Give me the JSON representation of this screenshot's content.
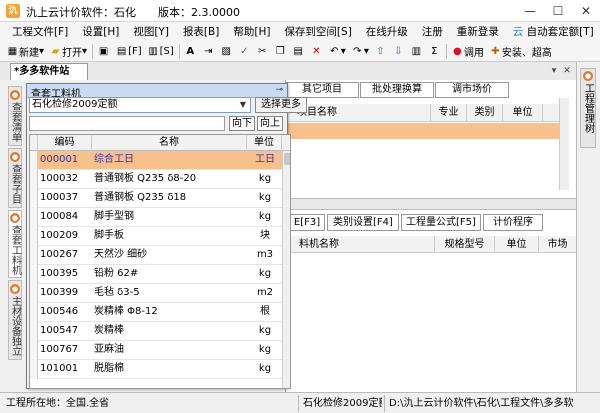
{
  "window": {
    "title": "氿上云计价软件：石化　　版本：2.3.0000",
    "controls": [
      "—",
      "☐",
      "✕"
    ]
  },
  "menu": [
    "工程文件[F]",
    "设置[H]",
    "视图[Y]",
    "报表[B]",
    "帮助[H]",
    "保存到空间[S]",
    "在线升级",
    "注册",
    "重新登录",
    "自动套定额[T]"
  ],
  "toolbar": {
    "new_label": "新建",
    "open_label": "打开",
    "f_label": "[F]",
    "s_label": "[S]",
    "call_label": "调用",
    "install_label": "安装、超高"
  },
  "doc_tab": "*多多软件站",
  "left_vtabs": [
    "查套清单",
    "查套子目",
    "查套工料机",
    "主材设备独立"
  ],
  "right_vtab": "工程管理树",
  "upper_tabs": [
    "其它项目",
    "批处理换算",
    "调市场价"
  ],
  "upper_grid_headers": [
    "项目名称",
    "专业",
    "类别",
    "单位"
  ],
  "lower_tabs": [
    "E[F3]",
    "类别设置[F4]",
    "工程量公式[F5]",
    "计价程序"
  ],
  "lower_grid_headers": [
    "料机名称",
    "规格型号",
    "单位",
    "市场"
  ],
  "dialog": {
    "title": "查套工料机",
    "pin": "⊸",
    "quota_selected": "石化检修2009定额",
    "select_more": "选择更多",
    "prev": "向下",
    "next": "向上",
    "headers": [
      "编码",
      "名称",
      "单位"
    ],
    "rows": [
      {
        "code": "000001",
        "name": "综合工日",
        "unit": "工日"
      },
      {
        "code": "100032",
        "name": "普通钢板 Q235 δ8-20",
        "unit": "kg"
      },
      {
        "code": "100037",
        "name": "普通钢板 Q235 δ18",
        "unit": "kg"
      },
      {
        "code": "100084",
        "name": "脚手型钢",
        "unit": "kg"
      },
      {
        "code": "100209",
        "name": "脚手板",
        "unit": "块"
      },
      {
        "code": "100267",
        "name": "天然沙 细砂",
        "unit": "m3"
      },
      {
        "code": "100395",
        "name": "铅粉 62#",
        "unit": "kg"
      },
      {
        "code": "100399",
        "name": "毛毡 δ3-5",
        "unit": "m2"
      },
      {
        "code": "100546",
        "name": "炭精棒 Φ8-12",
        "unit": "根"
      },
      {
        "code": "100547",
        "name": "炭精棒",
        "unit": "kg"
      },
      {
        "code": "100767",
        "name": "亚麻油",
        "unit": "kg"
      },
      {
        "code": "101001",
        "name": "脱脂棉",
        "unit": "kg"
      }
    ]
  },
  "status": {
    "location": "工程所在地：全国.全省",
    "quota": "石化检修2009定额",
    "path": "D:\\氿上云计价软件\\石化\\工程文件\\多多软"
  },
  "colors": {
    "selected_row": "#f8c08c",
    "dialog_header": "#c9daf2",
    "accent_orange": "#e27a2e"
  }
}
